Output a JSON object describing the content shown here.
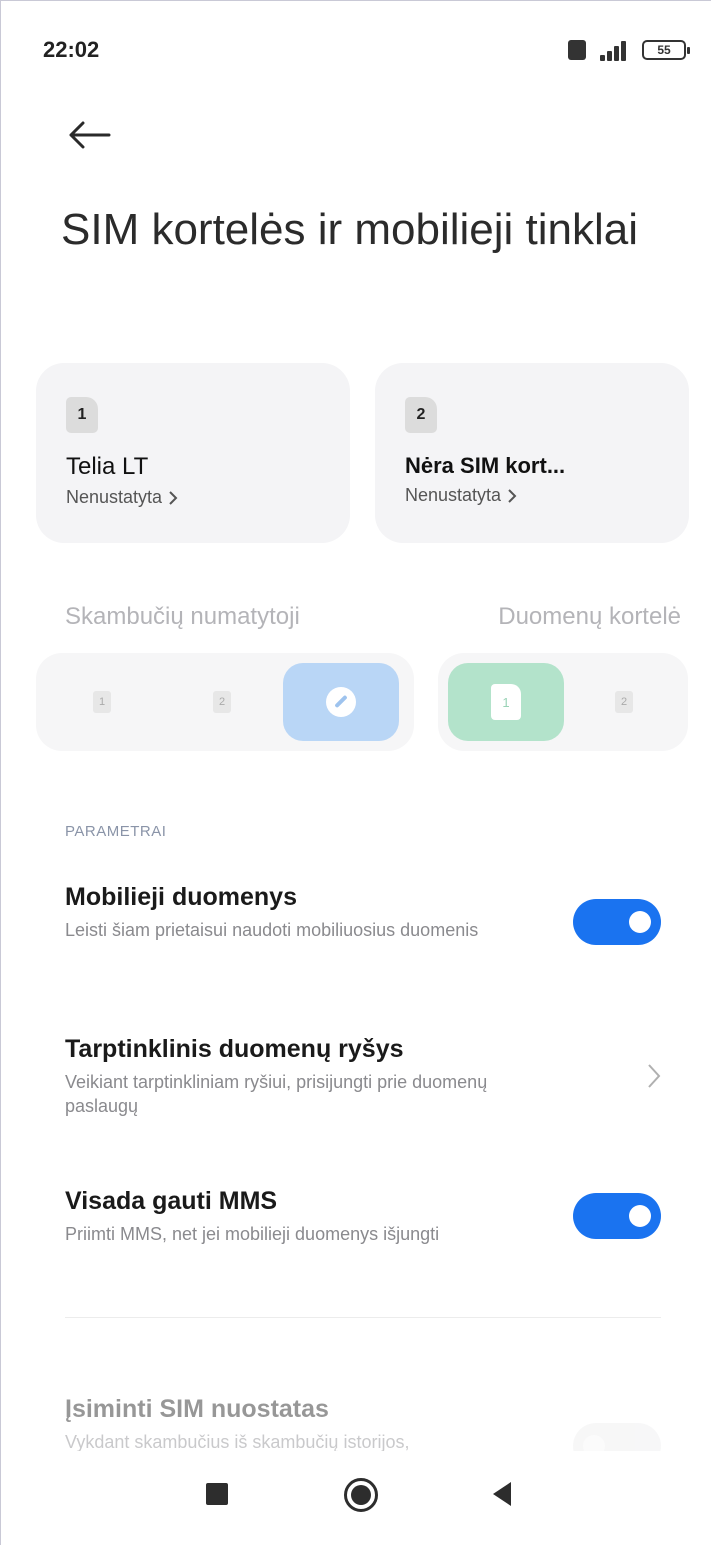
{
  "status_bar": {
    "time": "22:02",
    "battery": "55"
  },
  "page": {
    "title": "SIM kortelės ir mobilieji tinklai"
  },
  "sim_cards": [
    {
      "slot": "1",
      "name": "Telia LT",
      "status": "Nenustatyta"
    },
    {
      "slot": "2",
      "name": "Nėra SIM kort...",
      "status": "Nenustatyta"
    }
  ],
  "defaults": {
    "calls_label": "Skambučių numatytoji",
    "data_label": "Duomenų kortelė",
    "calls_options": [
      "1",
      "2"
    ],
    "data_options": [
      "1",
      "2"
    ],
    "calls_selected": "ask",
    "data_selected": "1"
  },
  "section": {
    "header": "PARAMETRAI"
  },
  "settings": [
    {
      "title": "Mobilieji duomenys",
      "subtitle": "Leisti šiam prietaisui naudoti mobiliuosius duomenis",
      "type": "toggle",
      "on": true
    },
    {
      "title": "Tarptinklinis duomenų ryšys",
      "subtitle": "Veikiant tarptinkliniam ryšiui, prisijungti prie duomenų paslaugų",
      "type": "chevron"
    },
    {
      "title": "Visada gauti MMS",
      "subtitle": "Priimti MMS, net jei mobilieji duomenys išjungti",
      "type": "toggle",
      "on": true
    },
    {
      "title": "Įsiminti SIM nuostatas",
      "subtitle": "Vykdant skambučius iš skambučių istorijos,",
      "type": "toggle",
      "on": false
    }
  ],
  "colors": {
    "accent": "#1a73f0",
    "calls_active": "#b9d6f6",
    "data_active": "#b3e3cb"
  },
  "icons": {
    "back": "arrow-left-icon",
    "nav_recents": "square-icon",
    "nav_home": "circle-icon",
    "nav_back": "triangle-left-icon"
  }
}
